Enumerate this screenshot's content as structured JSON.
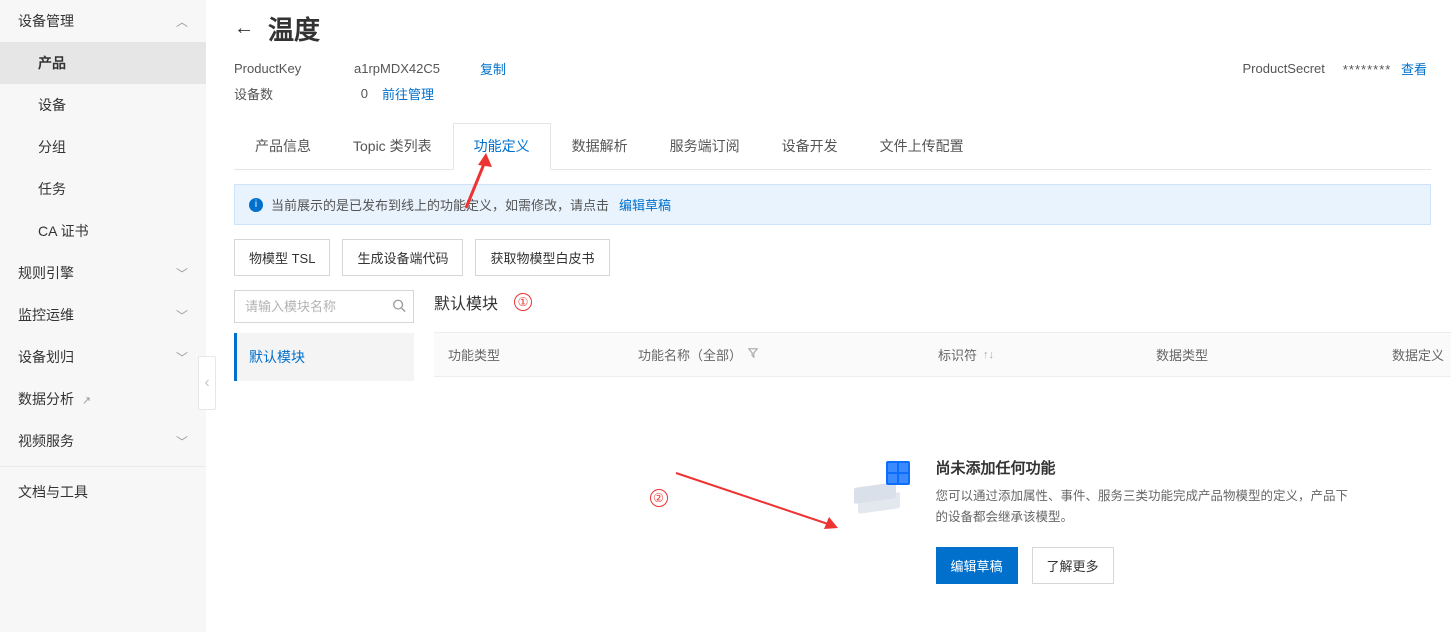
{
  "sidebar": {
    "groups": [
      {
        "label": "设备管理",
        "expanded": true,
        "items": [
          {
            "label": "产品",
            "active": true
          },
          {
            "label": "设备"
          },
          {
            "label": "分组"
          },
          {
            "label": "任务"
          },
          {
            "label": "CA 证书"
          }
        ]
      },
      {
        "label": "规则引擎",
        "expanded": false
      },
      {
        "label": "监控运维",
        "expanded": false
      },
      {
        "label": "设备划归",
        "expanded": false
      },
      {
        "label": "数据分析",
        "external": true
      },
      {
        "label": "视频服务",
        "expanded": false
      }
    ],
    "tools_label": "文档与工具"
  },
  "header": {
    "back_symbol": "←",
    "title": "温度"
  },
  "info": {
    "product_key_label": "ProductKey",
    "product_key_value": "a1rpMDX42C5",
    "copy_label": "复制",
    "device_count_label": "设备数",
    "device_count_value": "0",
    "device_manage_link": "前往管理",
    "product_secret_label": "ProductSecret",
    "product_secret_masked": "********",
    "view_label": "查看"
  },
  "tabs": [
    {
      "label": "产品信息"
    },
    {
      "label": "Topic 类列表"
    },
    {
      "label": "功能定义",
      "active": true
    },
    {
      "label": "数据解析"
    },
    {
      "label": "服务端订阅"
    },
    {
      "label": "设备开发"
    },
    {
      "label": "文件上传配置"
    }
  ],
  "notice": {
    "text": "当前展示的是已发布到线上的功能定义，如需修改，请点击",
    "link": "编辑草稿"
  },
  "actions": {
    "tsl": "物模型 TSL",
    "gen_code": "生成设备端代码",
    "whitepaper": "获取物模型白皮书"
  },
  "search": {
    "placeholder": "请输入模块名称"
  },
  "modules": {
    "default_label": "默认模块"
  },
  "section": {
    "title": "默认模块",
    "anno1": "①",
    "anno2": "②"
  },
  "table": {
    "col1": "功能类型",
    "col2": "功能名称（全部）",
    "col3": "标识符",
    "col4": "数据类型",
    "col5": "数据定义"
  },
  "empty": {
    "title": "尚未添加任何功能",
    "desc": "您可以通过添加属性、事件、服务三类功能完成产品物模型的定义，产品下的设备都会继承该模型。",
    "edit_draft": "编辑草稿",
    "learn_more": "了解更多"
  }
}
